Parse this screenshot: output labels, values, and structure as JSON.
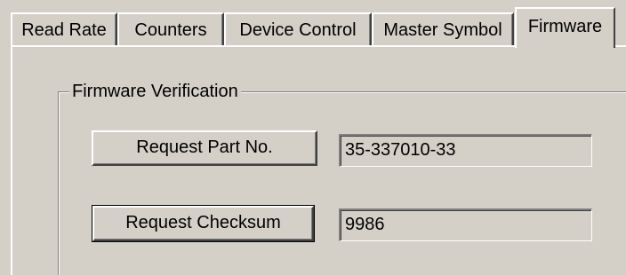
{
  "tabs": [
    {
      "label": "Read Rate",
      "active": false
    },
    {
      "label": "Counters",
      "active": false
    },
    {
      "label": "Device Control",
      "active": false
    },
    {
      "label": "Master Symbol",
      "active": false
    },
    {
      "label": "Firmware",
      "active": true
    }
  ],
  "firmware_verification": {
    "group_label": "Firmware Verification",
    "request_part_button_label": "Request Part No.",
    "part_number_value": "35-337010-33",
    "request_checksum_button_label": "Request Checksum",
    "checksum_value": "9986"
  },
  "colors": {
    "face": "#d4d0c8",
    "highlight": "#ffffff",
    "shadow": "#808080",
    "dark_shadow": "#404040"
  }
}
